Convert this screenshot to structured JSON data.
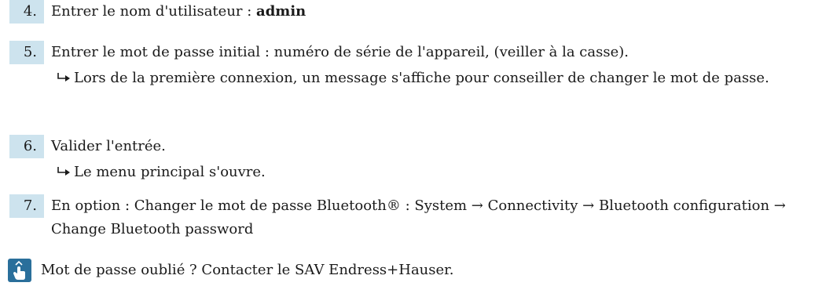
{
  "steps": [
    {
      "number": "4.",
      "text_before": "Entrer le nom d'utilisateur : ",
      "text_bold": "admin"
    },
    {
      "number": "5.",
      "text": "Entrer le mot de passe initial : numéro de série de l'appareil, (veiller à la casse).",
      "result": "Lors de la première connexion, un message s'affiche pour conseiller de changer le mot de passe."
    },
    {
      "number": "6.",
      "text": "Valider l'entrée.",
      "result": "Le menu principal s'ouvre."
    },
    {
      "number": "7.",
      "text": "En option : Changer le mot de passe Bluetooth® : System → Connectivity → Bluetooth configuration → Change Bluetooth password"
    }
  ],
  "note": {
    "icon": "hand-pointer-tip-icon",
    "text": "Mot de passe oublié ? Contacter le SAV Endress+Hauser."
  },
  "colors": {
    "step_number_background": "#cde3ee",
    "note_icon_background": "#2a6f9b",
    "text": "#1a1a1a"
  }
}
